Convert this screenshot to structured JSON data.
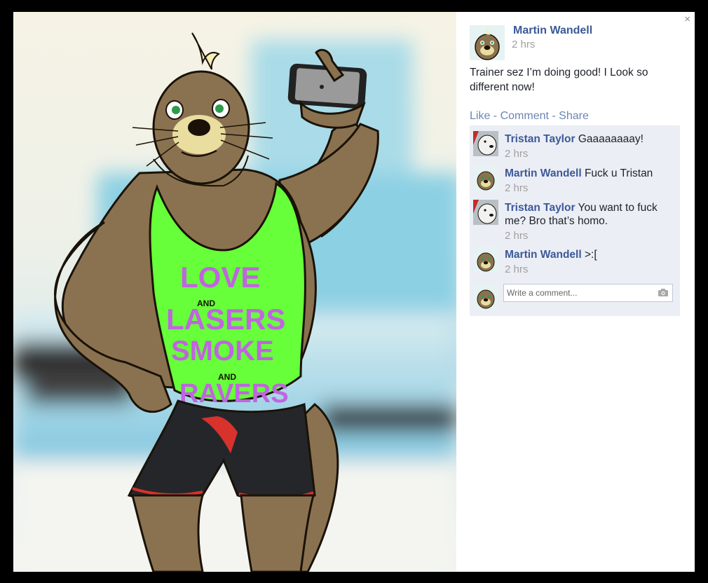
{
  "close_symbol": "×",
  "post": {
    "author": "Martin Wandell",
    "time": "2 hrs",
    "text": "Trainer sez I’m doing good! I Look so different now!"
  },
  "actions": {
    "like": "Like",
    "comment": "Comment",
    "share": "Share",
    "sep": " - "
  },
  "comments": [
    {
      "name": "Tristan Taylor",
      "text": "Gaaaaaaaay!",
      "time": "2 hrs",
      "avatar": "white-otter-avatar"
    },
    {
      "name": "Martin Wandell",
      "text": "Fuck u Tristan",
      "time": "2 hrs",
      "avatar": "otter-avatar"
    },
    {
      "name": "Tristan Taylor",
      "text": "You want to fuck me? Bro that’s homo.",
      "time": "2 hrs",
      "avatar": "white-otter-avatar"
    },
    {
      "name": "Martin Wandell",
      "text": ">:[",
      "time": "2 hrs",
      "avatar": "otter-avatar"
    }
  ],
  "write_comment": {
    "placeholder": "Write a comment...",
    "icon": "camera-icon"
  },
  "shirt": {
    "line1": "LOVE",
    "and1": "AND",
    "line2": "LASERS",
    "line3": "SMOKE",
    "and2": "AND",
    "line4": "RAVERS"
  },
  "colors": {
    "link": "#3b5998",
    "action_link": "#6d84b4",
    "comment_bg": "#eceef5",
    "shirt": "#66ff3a",
    "shirt_text": "#c064e0",
    "fur": "#8a7250"
  }
}
